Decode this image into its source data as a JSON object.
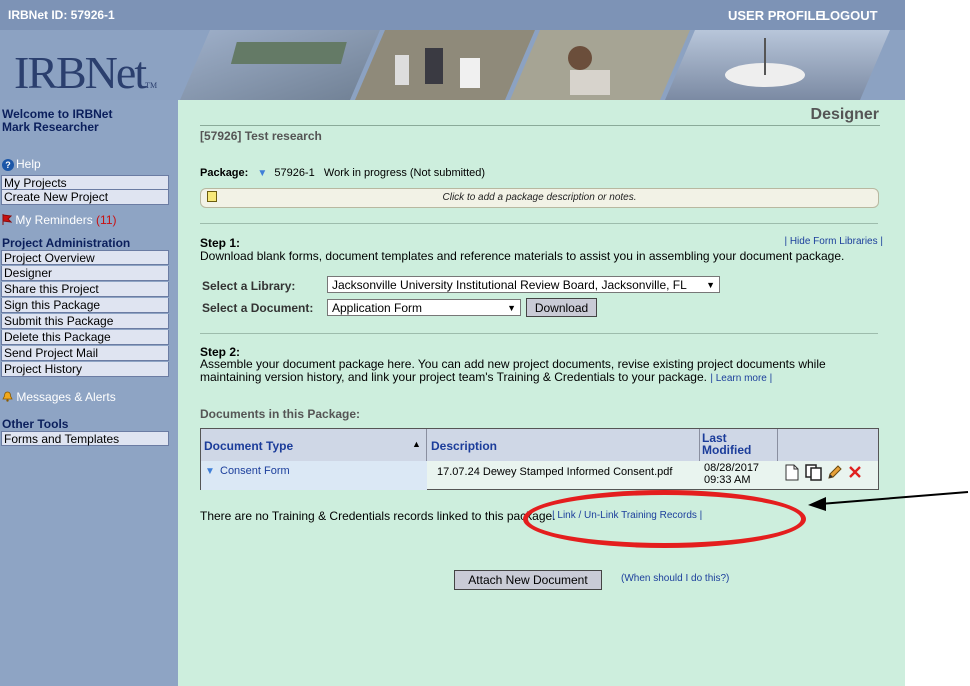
{
  "top_bar": {
    "irbnet_id": "IRBNet ID: 57926-1",
    "user_profile": "USER PROFILE",
    "logout": "LOGOUT"
  },
  "banner": {
    "logo": "IRBNet",
    "logo_tm": "TM"
  },
  "sidebar": {
    "welcome_line1": "Welcome to IRBNet",
    "welcome_line2": "Mark Researcher",
    "help": "Help",
    "my_projects": "My Projects",
    "create_new_project": "Create New Project",
    "my_reminders": "My Reminders",
    "reminders_count": "(11)",
    "project_admin_heading": "Project Administration",
    "project_admin_items": [
      "Project Overview",
      "Designer",
      "Share this Project",
      "Sign this Package",
      "Submit this Package",
      "Delete this Package",
      "Send Project Mail",
      "Project History"
    ],
    "messages_alerts": "Messages & Alerts",
    "other_tools_heading": "Other Tools",
    "forms_and_templates": "Forms and Templates"
  },
  "main": {
    "page_title": "Designer",
    "project_title": "[57926] Test research",
    "package_label": "Package:",
    "package_id": "57926-1",
    "package_status": "Work in progress (Not submitted)",
    "note_placeholder": "Click to add a package description or notes.",
    "step1_title": "Step 1:",
    "hide_form_libraries": "| Hide Form Libraries |",
    "step1_description": "Download blank forms, document templates and reference materials to assist you in assembling your document package.",
    "select_library_label": "Select a Library:",
    "selected_library": "Jacksonville University Institutional Review Board, Jacksonville, FL",
    "select_document_label": "Select a Document:",
    "selected_document": "Application Form",
    "download_button": "Download",
    "step2_title": "Step 2:",
    "step2_description": "Assemble your document package here. You can add new project documents, revise existing project documents while maintaining version history, and link your project team's Training & Credentials to your package.",
    "learn_more": "| Learn more |",
    "documents_heading": "Documents in this Package:",
    "table": {
      "columns": [
        "Document Type",
        "Description",
        "Last Modified"
      ],
      "rows": [
        {
          "document_type": "Consent Form",
          "description": "17.07.24 Dewey Stamped Informed Consent.pdf",
          "last_modified": "08/28/2017",
          "last_modified_time": "09:33 AM"
        }
      ]
    },
    "no_training_text": "There are no Training & Credentials records linked to this package.",
    "link_training": "| Link / Un-Link Training Records |",
    "attach_button": "Attach New Document",
    "when_link": "(When should I do this?)"
  },
  "colors": {
    "main_background": "#cdeedd",
    "sidebar_background": "#8ea4c4",
    "annotation_red": "#e41e1e",
    "link_blue": "#1c3f9c"
  }
}
